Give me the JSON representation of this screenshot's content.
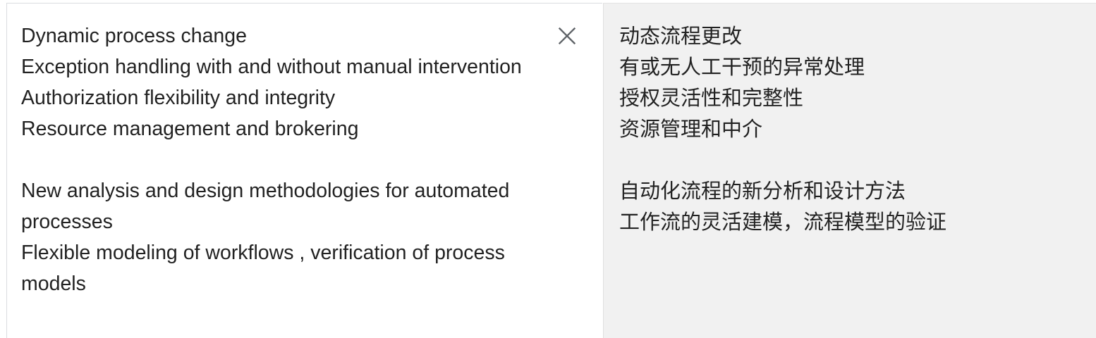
{
  "source": {
    "text": "Dynamic process change\nException handling with and without manual intervention\nAuthorization flexibility and integrity\nResource management and brokering\n\nNew analysis and design methodologies for automated processes\nFlexible modeling of workflows , verification of process models"
  },
  "target": {
    "text": "动态流程更改\n有或无人工干预的异常处理\n授权灵活性和完整性\n资源管理和中介\n\n自动化流程的新分析和设计方法\n工作流的灵活建模，流程模型的验证"
  },
  "icons": {
    "clear": "close-icon"
  },
  "colors": {
    "text": "#222222",
    "target_background": "#f1f1f1",
    "icon": "#5f6368"
  }
}
